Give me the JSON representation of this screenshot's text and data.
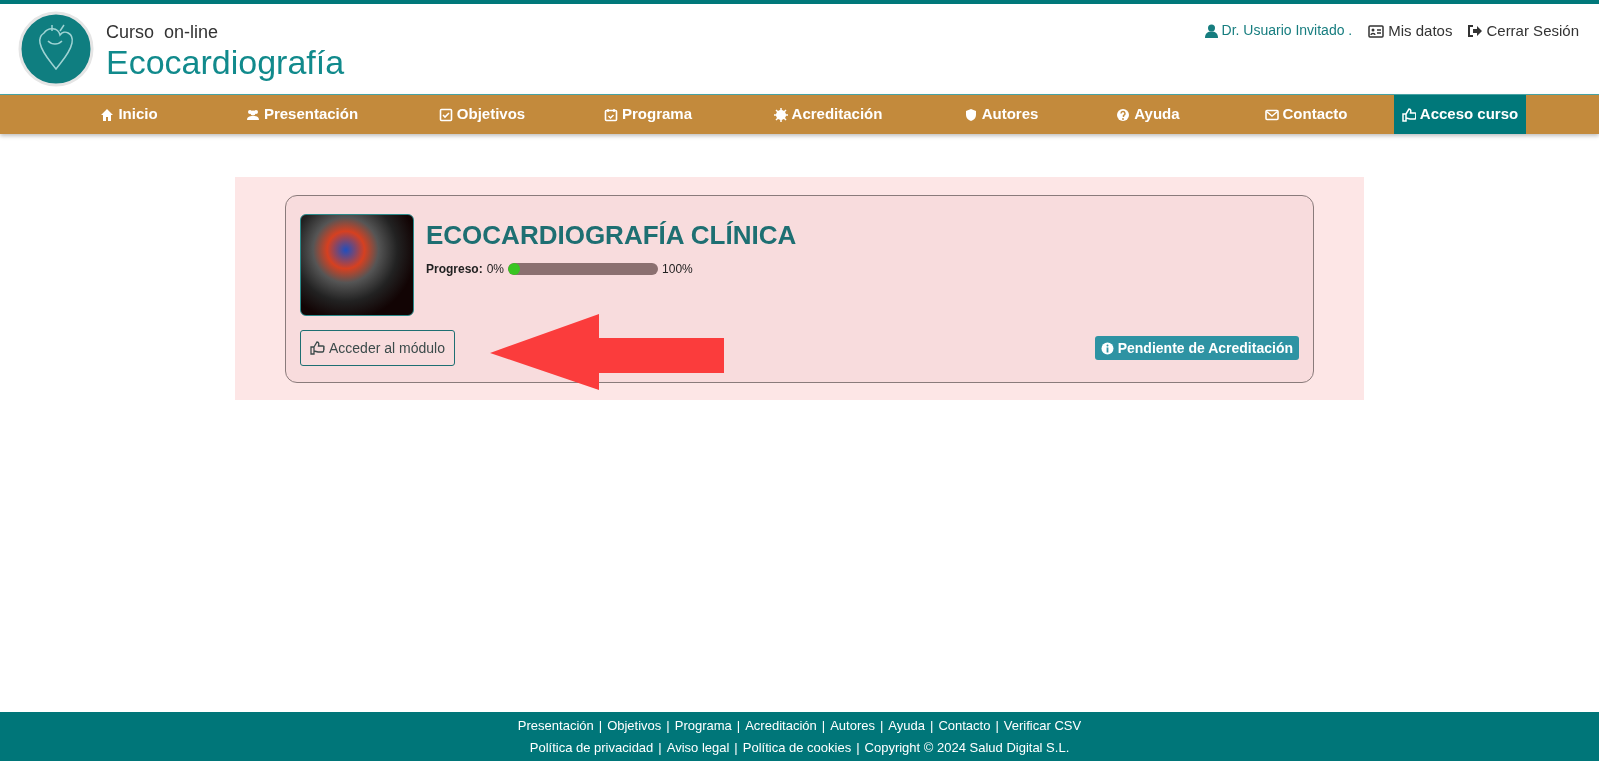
{
  "header": {
    "title_small": "Curso  on-line",
    "title_large": "Ecocardiografía",
    "user": "Dr. Usuario Invitado .",
    "links": [
      "Mis datos",
      "Cerrar Sesión"
    ]
  },
  "nav": [
    {
      "label": "Inicio",
      "selected": false
    },
    {
      "label": "Presentación",
      "selected": false
    },
    {
      "label": "Objetivos",
      "selected": false
    },
    {
      "label": "Programa",
      "selected": false
    },
    {
      "label": "Acreditación",
      "selected": false
    },
    {
      "label": "Autores",
      "selected": false
    },
    {
      "label": "Ayuda",
      "selected": false
    },
    {
      "label": "Contacto",
      "selected": false
    },
    {
      "label": "Acceso curso",
      "selected": true
    }
  ],
  "course": {
    "title": "ECOCARDIOGRAFÍA CLÍNICA",
    "progress_label": "Progreso:",
    "progress_min": "0%",
    "progress": {
      "level": 0.03
    },
    "progress_max": "100%",
    "button": "Acceder al módulo",
    "status": "Pendiente de Acreditación"
  },
  "footer": {
    "separator": "|",
    "links": [
      "Presentación",
      "Objetivos",
      "Programa",
      "Acreditación",
      "Autores",
      "Ayuda",
      "Contacto",
      "Verificar CSV"
    ],
    "legal_links": [
      "Política de privacidad",
      "Aviso legal",
      "Política de cookies",
      "Copyright © 2024 Salud Digital S.L."
    ]
  }
}
